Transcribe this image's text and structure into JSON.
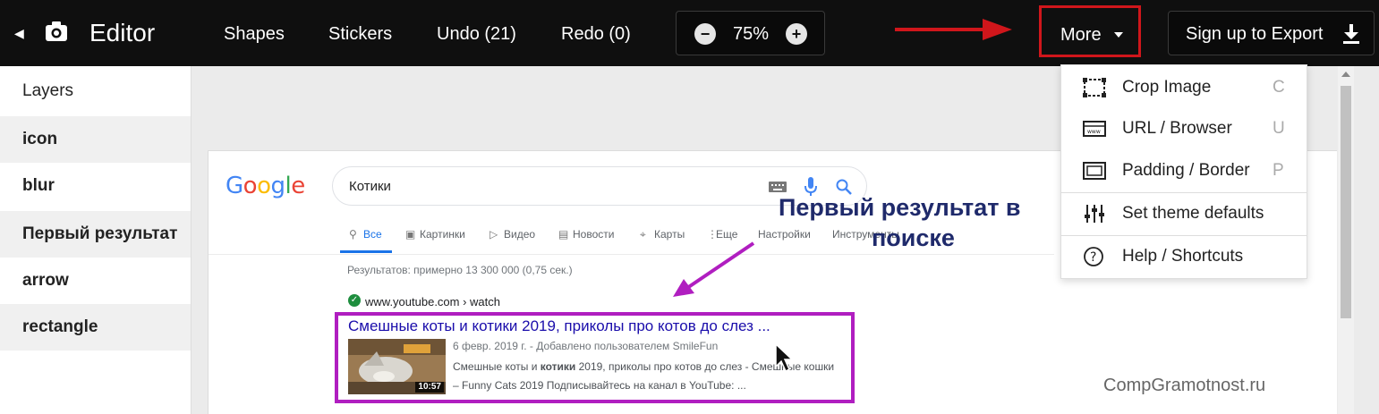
{
  "toolbar": {
    "app_title": "Editor",
    "shapes": "Shapes",
    "stickers": "Stickers",
    "undo": "Undo (21)",
    "redo": "Redo (0)",
    "zoom_minus": "−",
    "zoom_level": "75%",
    "zoom_plus": "+",
    "more": "More",
    "export": "Sign up to Export",
    "icons": {
      "back": "chevron-left-icon",
      "camera": "camera-icon",
      "export": "download-icon"
    }
  },
  "layers": {
    "title": "Layers",
    "items": [
      {
        "label": "icon"
      },
      {
        "label": "blur"
      },
      {
        "label": "Первый результат"
      },
      {
        "label": "arrow"
      },
      {
        "label": "rectangle"
      }
    ]
  },
  "menu": {
    "items": [
      {
        "label": "Crop Image",
        "key": "C",
        "icon": "crop-icon"
      },
      {
        "label": "URL / Browser",
        "key": "U",
        "icon": "browser-icon"
      },
      {
        "label": "Padding / Border",
        "key": "P",
        "icon": "border-icon"
      },
      {
        "label": "Set theme defaults",
        "key": "",
        "icon": "sliders-icon"
      },
      {
        "label": "Help / Shortcuts",
        "key": "",
        "icon": "help-icon"
      }
    ]
  },
  "screenshot": {
    "logo_letters": [
      "G",
      "o",
      "o",
      "g",
      "l",
      "e"
    ],
    "logo_colors": [
      "#4285f4",
      "#ea4335",
      "#fbbc05",
      "#4285f4",
      "#34a853",
      "#ea4335"
    ],
    "query": "Котики",
    "tabs": [
      {
        "label": "Все",
        "icon": "search-icon",
        "active": true
      },
      {
        "label": "Картинки",
        "icon": "image-icon"
      },
      {
        "label": "Видео",
        "icon": "play-icon"
      },
      {
        "label": "Новости",
        "icon": "news-icon"
      },
      {
        "label": "Карты",
        "icon": "pin-icon"
      },
      {
        "label": "Еще",
        "icon": "more-vert-icon"
      },
      {
        "label": "Настройки",
        "icon": ""
      },
      {
        "label": "Инструменты",
        "icon": ""
      }
    ],
    "results_count": "Результатов: примерно 13 300 000 (0,75 сек.)",
    "result": {
      "cite": "www.youtube.com › watch",
      "title": "Смешные коты и котики 2019, приколы про котов до слез ...",
      "duration": "10:57",
      "date": "6 февр. 2019 г. - Добавлено пользователем SmileFun",
      "snippet_pre": "Смешные коты и ",
      "snippet_bold": "котики",
      "snippet_post": " 2019, приколы про котов до слез - Смешные кошки – Funny Cats 2019 Подписывайтесь на канал в YouTube: ..."
    },
    "annotation": [
      "Первый результат в",
      "поиске"
    ],
    "watermark": "CompGramotnost.ru"
  },
  "colors": {
    "toolbar_bg": "#0f0f0f",
    "highlight_red": "#d0161b",
    "annotation_purple": "#b01ec0",
    "annotation_text": "#1f2a6b",
    "link_blue": "#1a0dab",
    "tab_blue": "#1a73e8"
  }
}
